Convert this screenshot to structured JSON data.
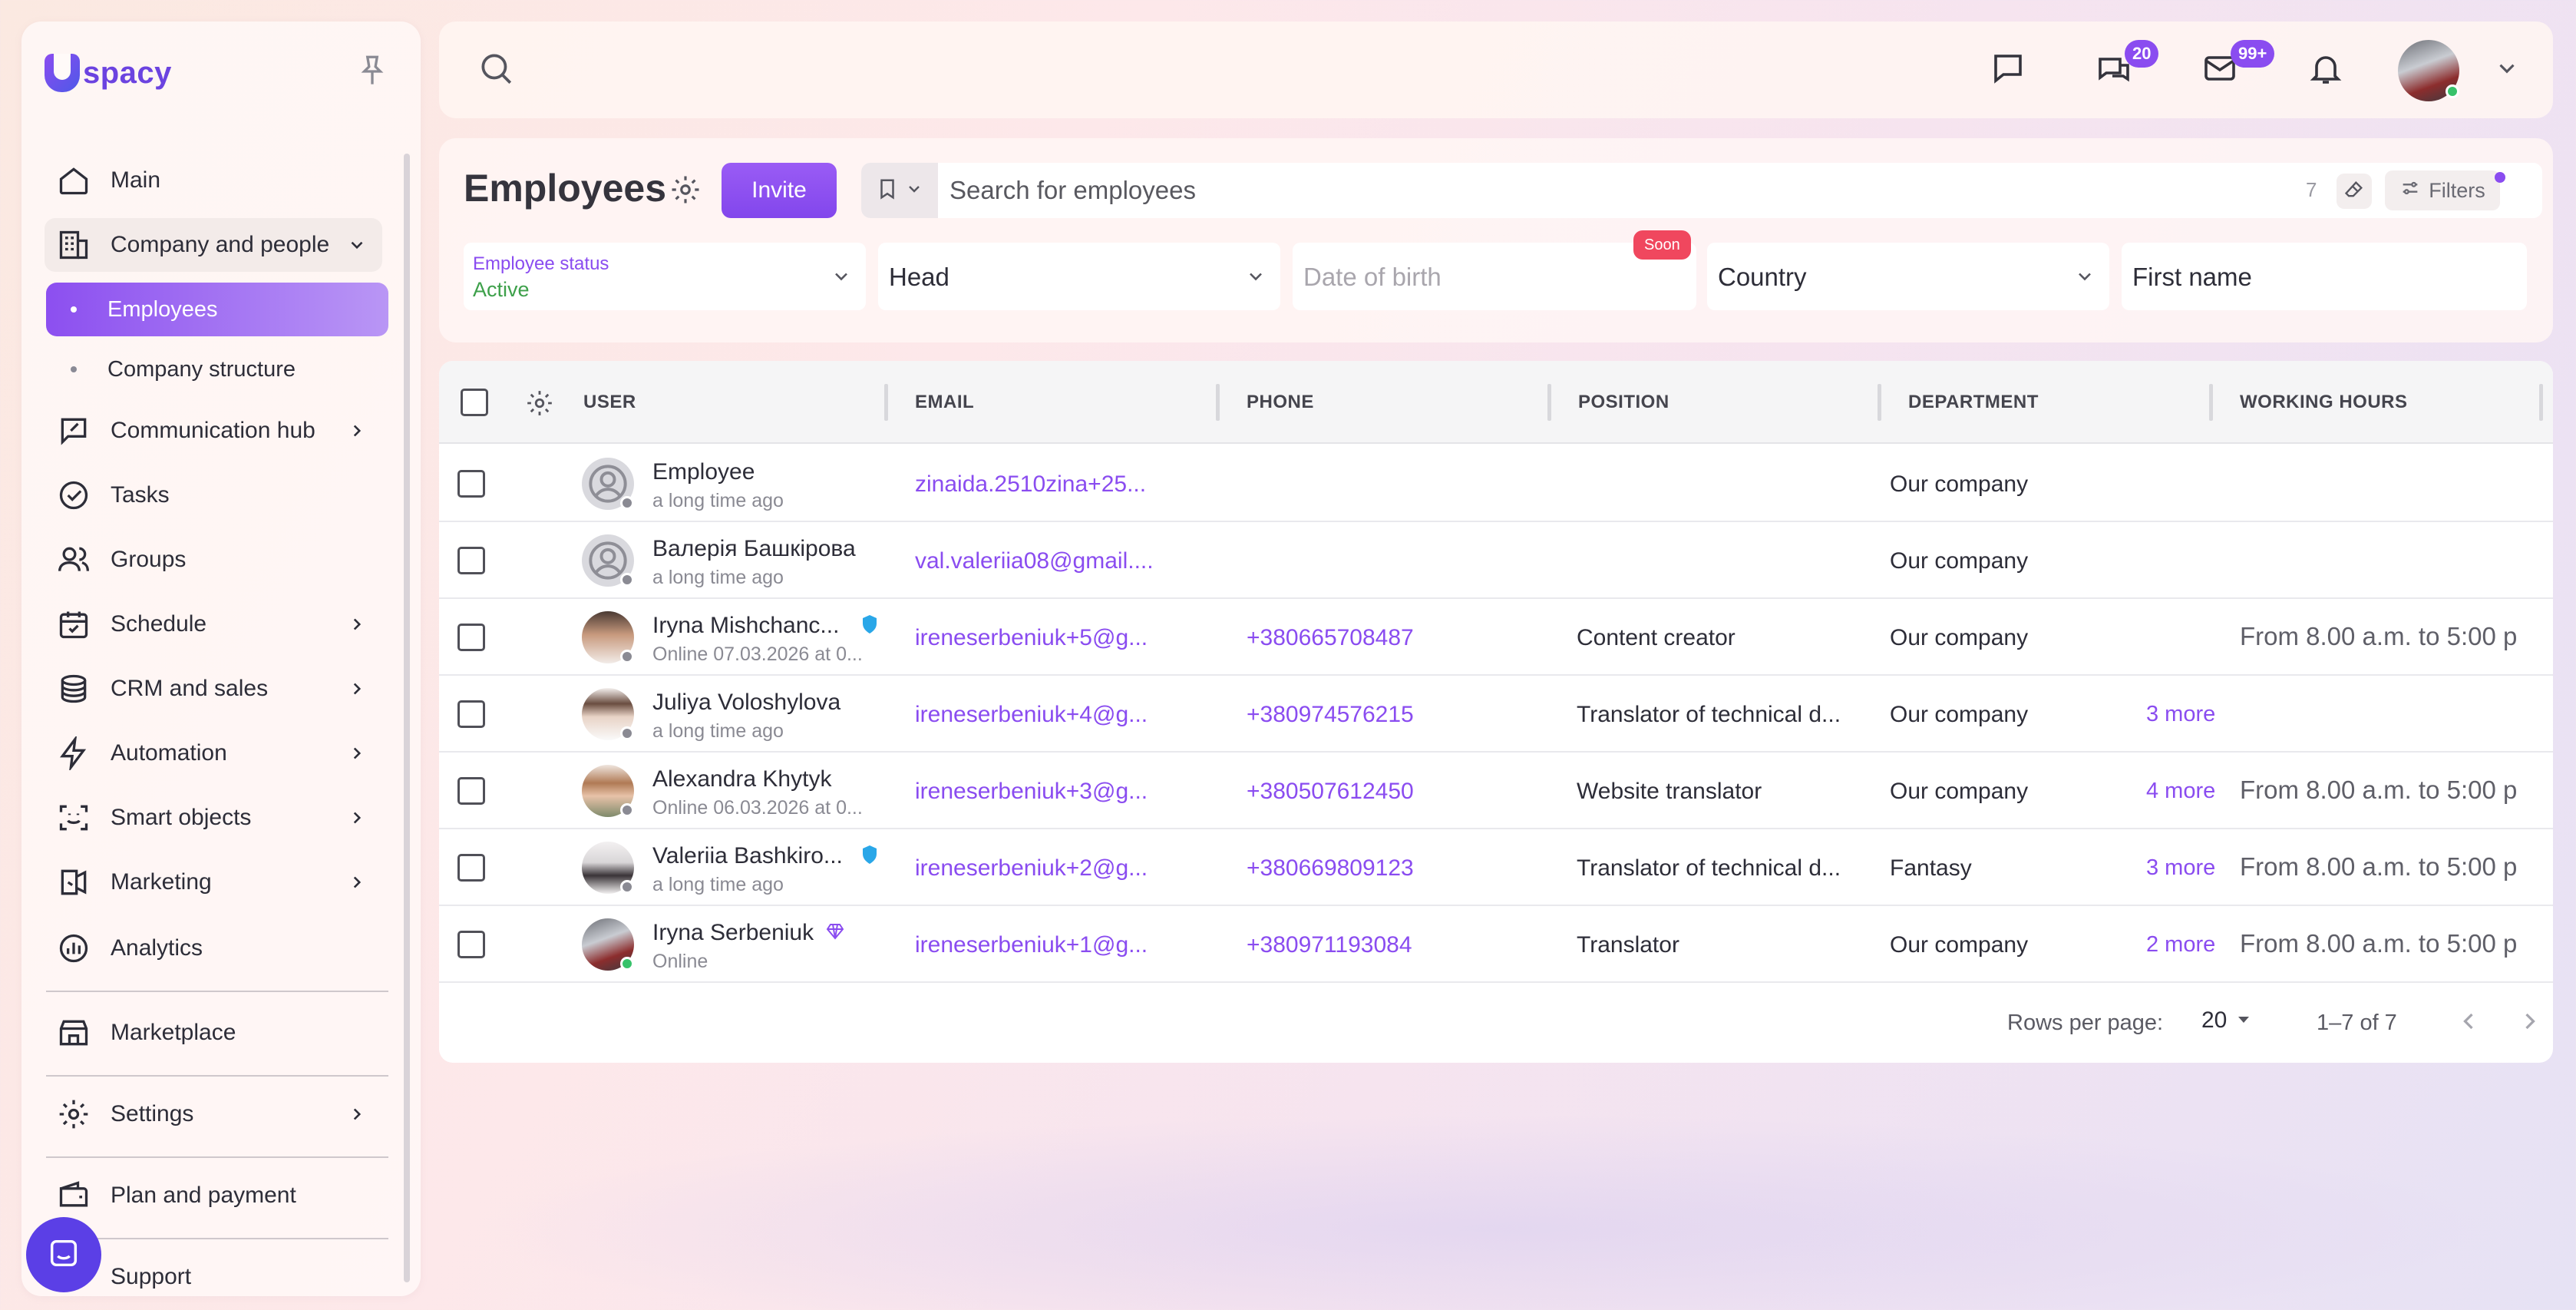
{
  "app": {
    "name": "spacy"
  },
  "sidebar": {
    "items": [
      {
        "label": "Main",
        "icon": "home-icon"
      },
      {
        "label": "Company and people",
        "icon": "building-icon"
      },
      {
        "label": "Employees"
      },
      {
        "label": "Company structure"
      },
      {
        "label": "Communication hub",
        "icon": "chat-edit-icon"
      },
      {
        "label": "Tasks",
        "icon": "check-circle-icon"
      },
      {
        "label": "Groups",
        "icon": "people-icon"
      },
      {
        "label": "Schedule",
        "icon": "calendar-icon"
      },
      {
        "label": "CRM and sales",
        "icon": "coins-icon"
      },
      {
        "label": "Automation",
        "icon": "lightning-icon"
      },
      {
        "label": "Smart objects",
        "icon": "scan-face-icon"
      },
      {
        "label": "Marketing",
        "icon": "megaphone-icon"
      },
      {
        "label": "Analytics",
        "icon": "chart-circle-icon"
      },
      {
        "label": "Marketplace",
        "icon": "store-icon"
      },
      {
        "label": "Settings",
        "icon": "gear-icon"
      },
      {
        "label": "Plan and payment",
        "icon": "wallet-icon"
      },
      {
        "label": "Support",
        "icon": "chat-bubble-icon"
      }
    ]
  },
  "topbar": {
    "chat_badge": "20",
    "mail_badge": "99+"
  },
  "employees": {
    "title": "Employees",
    "invite_label": "Invite",
    "search_placeholder": "Search for employees",
    "result_count": "7",
    "filters_label": "Filters",
    "filters": {
      "status_label": "Employee status",
      "status_value": "Active",
      "head": "Head",
      "date_of_birth": "Date of birth",
      "soon_badge": "Soon",
      "country": "Country",
      "first_name": "First name"
    }
  },
  "table": {
    "columns": [
      "USER",
      "EMAIL",
      "PHONE",
      "POSITION",
      "DEPARTMENT",
      "WORKING HOURS"
    ],
    "rows": [
      {
        "name": "Employee",
        "status": "a long time ago",
        "email": "zinaida.2510zina+25...",
        "phone": "",
        "position": "",
        "department": "Our company",
        "more": "",
        "hours": ""
      },
      {
        "name": "Валерія Башкірова",
        "status": "a long time ago",
        "email": "val.valeriia08@gmail....",
        "phone": "",
        "position": "",
        "department": "Our company",
        "more": "",
        "hours": ""
      },
      {
        "name": "Iryna Mishchanc...",
        "status": "Online 07.03.2026 at 0...",
        "email": "ireneserbeniuk+5@g...",
        "phone": "+380665708487",
        "position": "Content creator",
        "department": "Our company",
        "more": "",
        "hours": "From 8.00 a.m. to 5:00 p"
      },
      {
        "name": "Juliya Voloshylova",
        "status": "a long time ago",
        "email": "ireneserbeniuk+4@g...",
        "phone": "+380974576215",
        "position": "Translator of technical d...",
        "department": "Our company",
        "more": "3 more",
        "hours": ""
      },
      {
        "name": "Alexandra Khytyk",
        "status": "Online 06.03.2026 at 0...",
        "email": "ireneserbeniuk+3@g...",
        "phone": "+380507612450",
        "position": "Website translator",
        "department": "Our company",
        "more": "4 more",
        "hours": "From 8.00 a.m. to 5:00 p"
      },
      {
        "name": "Valeriia Bashkiro...",
        "status": "a long time ago",
        "email": "ireneserbeniuk+2@g...",
        "phone": "+380669809123",
        "position": "Translator of technical d...",
        "department": "Fantasy",
        "more": "3 more",
        "hours": "From 8.00 a.m. to 5:00 p"
      },
      {
        "name": "Iryna Serbeniuk",
        "status": "Online",
        "email": "ireneserbeniuk+1@g...",
        "phone": "+380971193084",
        "position": "Translator",
        "department": "Our company",
        "more": "2 more",
        "hours": "From 8.00 a.m. to 5:00 p"
      }
    ],
    "footer": {
      "rows_per_page_label": "Rows per page:",
      "rows_per_page_value": "20",
      "range": "1–7 of 7"
    }
  },
  "colors": {
    "accent": "#8a4cf0",
    "online": "#37c26a",
    "active_status": "#3da04a",
    "soon": "#f0475e"
  }
}
